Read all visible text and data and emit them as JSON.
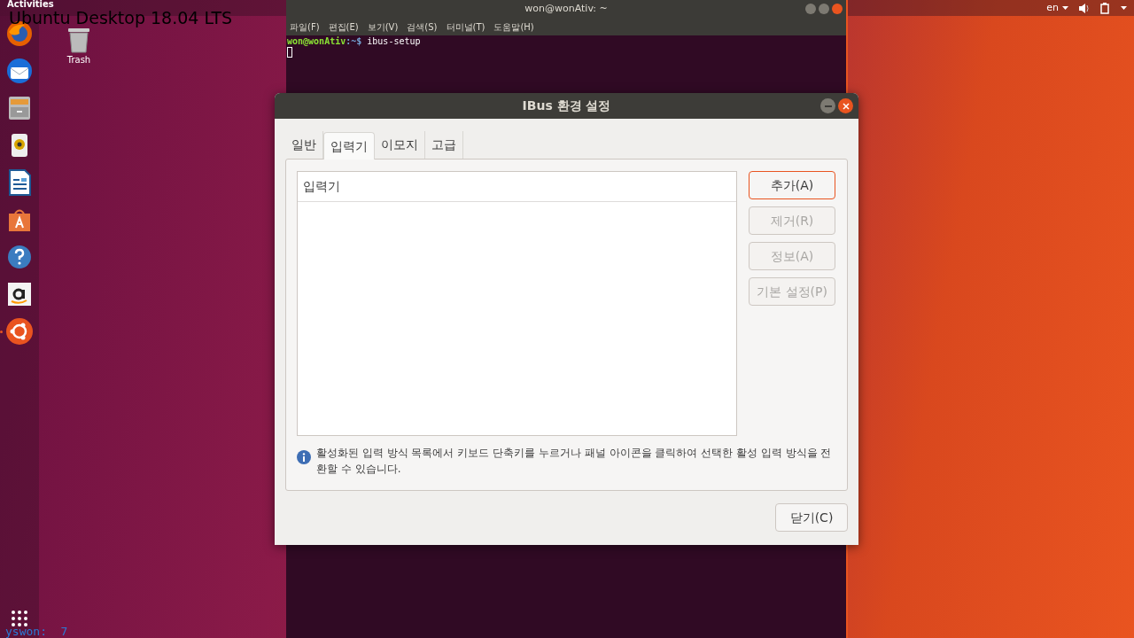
{
  "caption": "Ubuntu Desktop 18.04 LTS",
  "top_bar": {
    "activities": "Activities",
    "language": "en"
  },
  "dock": {
    "apps": [
      {
        "kind": "firefox"
      },
      {
        "kind": "mail"
      },
      {
        "kind": "files"
      },
      {
        "kind": "speaker"
      },
      {
        "kind": "writer"
      },
      {
        "kind": "software"
      },
      {
        "kind": "help"
      },
      {
        "kind": "amazon"
      },
      {
        "kind": "ubuntu",
        "running": true
      }
    ]
  },
  "desktop_icons": [
    {
      "label": "Trash"
    }
  ],
  "terminal": {
    "title": "won@wonAtiv: ~",
    "menu": [
      "파일(F)",
      "편집(E)",
      "보기(V)",
      "검색(S)",
      "터미널(T)",
      "도움말(H)"
    ],
    "prompt": "won@wonAtiv",
    "path": ":~$",
    "command": "ibus-setup"
  },
  "dialog": {
    "title": "IBus 환경 설정",
    "tabs": [
      {
        "label": "일반",
        "selected": false
      },
      {
        "label": "입력기",
        "selected": true
      },
      {
        "label": "이모지",
        "selected": false
      },
      {
        "label": "고급",
        "selected": false
      }
    ],
    "list": {
      "header": "입력기"
    },
    "buttons": [
      {
        "label": "추가(A)",
        "disabled": false,
        "focused": true
      },
      {
        "label": "제거(R)",
        "disabled": true,
        "focused": false
      },
      {
        "label": "정보(A)",
        "disabled": true,
        "focused": false
      },
      {
        "label": "기본 설정(P)",
        "disabled": true,
        "focused": false
      }
    ],
    "info": "활성화된 입력 방식 목록에서 키보드 단축키를 누르거나 패널 아이콘을 클릭하여 선택한 활성 입력 방식을 전환할 수 있습니다.",
    "close_button": "닫기(C)"
  },
  "recorder_label": "yswon:  7"
}
